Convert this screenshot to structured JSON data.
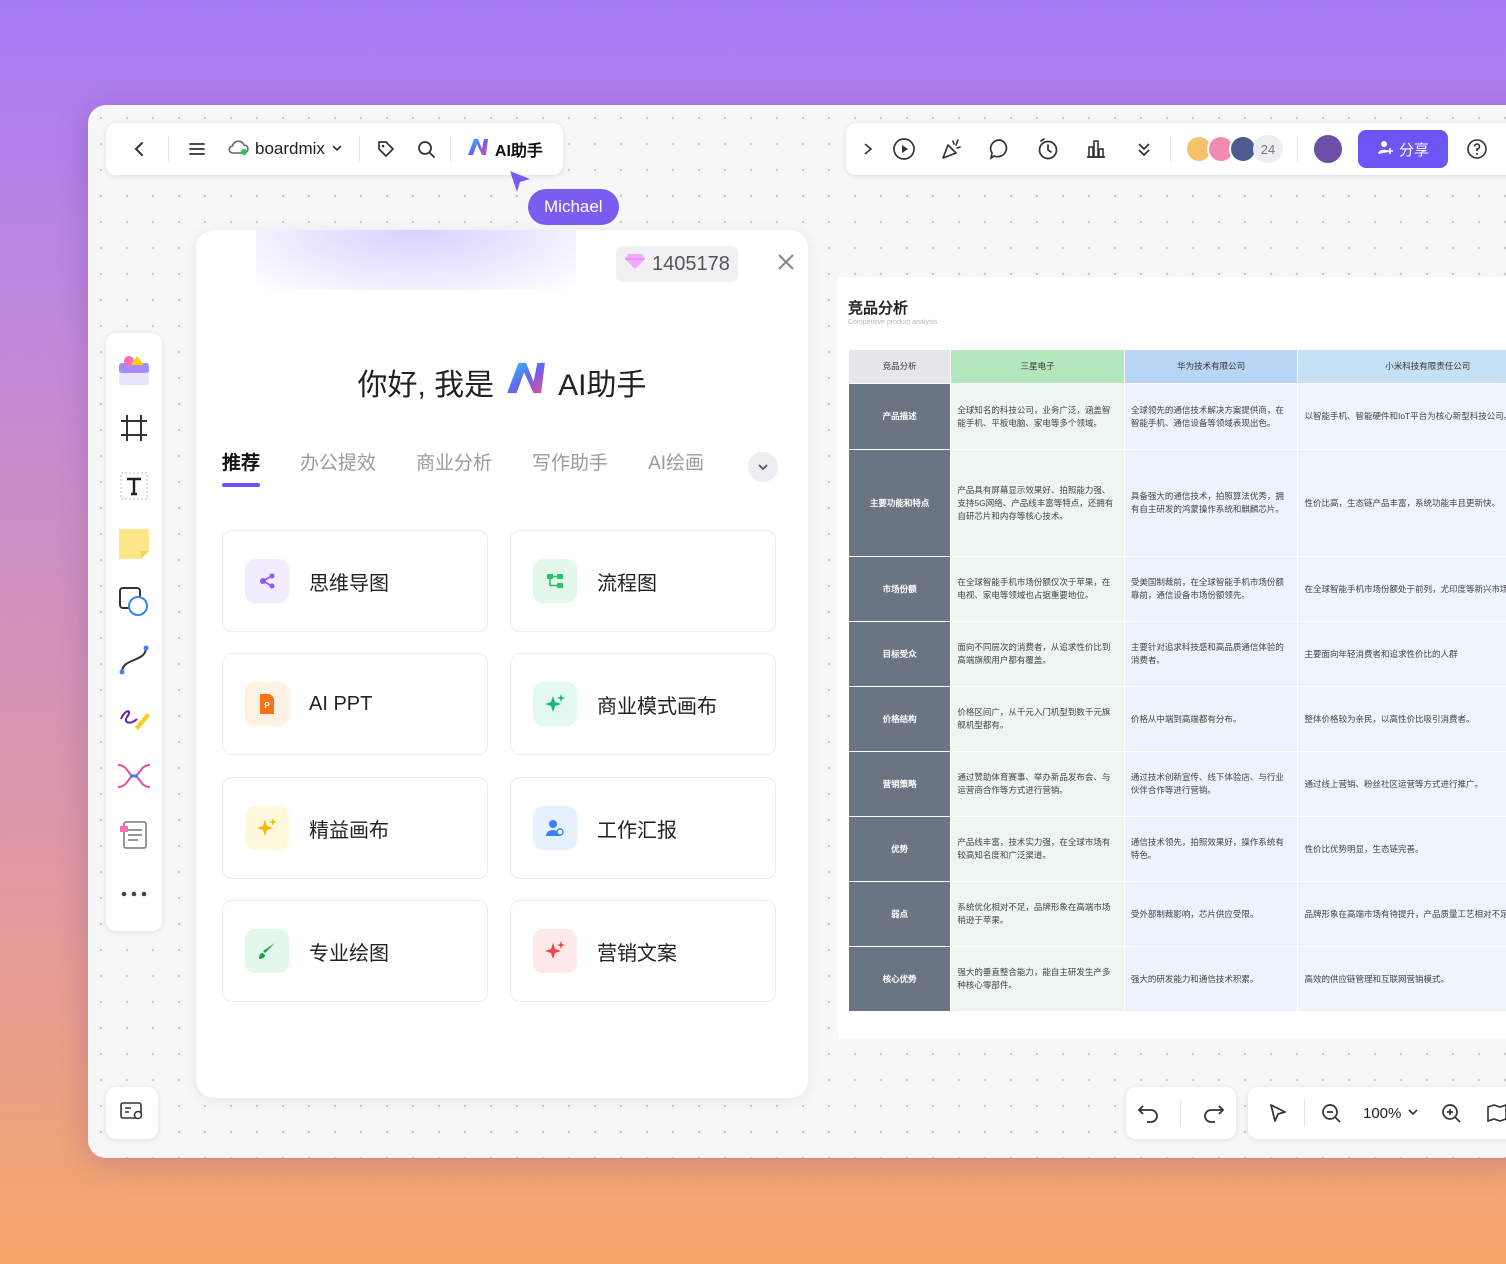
{
  "toolbar_left": {
    "brand": "boardmix",
    "ai_label": "AI助手"
  },
  "toolbar_right": {
    "collaborator_count": "24",
    "share_label": "分享"
  },
  "cursor": {
    "user": "Michael"
  },
  "ai_panel": {
    "credits": "1405178",
    "greeting_prefix": "你好, 我是",
    "greeting_suffix": "AI助手",
    "tabs": [
      "推荐",
      "办公提效",
      "商业分析",
      "写作助手",
      "AI绘画"
    ],
    "cards": [
      {
        "label": "思维导图",
        "icon": "mindmap-icon",
        "color": "#8b5cf6"
      },
      {
        "label": "流程图",
        "icon": "flowchart-icon",
        "color": "#22c55e"
      },
      {
        "label": "AI PPT",
        "icon": "ppt-icon",
        "color": "#f97316"
      },
      {
        "label": "商业模式画布",
        "icon": "sparkle-icon",
        "color": "#10b981"
      },
      {
        "label": "精益画布",
        "icon": "sparkle-icon",
        "color": "#f5b800"
      },
      {
        "label": "工作汇报",
        "icon": "user-report-icon",
        "color": "#3b82f6"
      },
      {
        "label": "专业绘图",
        "icon": "brush-icon",
        "color": "#16a34a"
      },
      {
        "label": "营销文案",
        "icon": "sparkle-icon",
        "color": "#ef4444"
      }
    ]
  },
  "sheet": {
    "title": "竞品分析",
    "subtitle": "Competitive product analysis",
    "headers": [
      "竞品分析",
      "三星电子",
      "华为技术有限公司",
      "小米科技有限责任公司"
    ],
    "rows": [
      {
        "label": "产品描述",
        "c1": "全球知名的科技公司，业务广泛，涵盖智能手机、平板电脑、家电等多个领域。",
        "c2": "全球领先的通信技术解决方案提供商，在智能手机、通信设备等领域表现出色。",
        "c3": "以智能手机、智能硬件和IoT平台为核心新型科技公司。"
      },
      {
        "label": "主要功能和特点",
        "c1": "产品具有屏幕显示效果好、拍照能力强、支持5G网络、产品线丰富等特点，还拥有自研芯片和内存等核心技术。",
        "c2": "具备强大的通信技术，拍照算法优秀，拥有自主研发的鸿蒙操作系统和麒麟芯片。",
        "c3": "性价比高，生态链产品丰富，系统功能丰且更新快。"
      },
      {
        "label": "市场份额",
        "c1": "在全球智能手机市场份额仅次于苹果，在电视、家电等领域也占据重要地位。",
        "c2": "受美国制裁前，在全球智能手机市场份额靠前，通信设备市场份额领先。",
        "c3": "在全球智能手机市场份额处于前列，尤印度等新兴市场表现突出。"
      },
      {
        "label": "目标受众",
        "c1": "面向不同层次的消费者，从追求性价比到高端旗舰用户都有覆盖。",
        "c2": "主要针对追求科技感和高品质通信体验的消费者。",
        "c3": "主要面向年轻消费者和追求性价比的人群"
      },
      {
        "label": "价格结构",
        "c1": "价格区间广，从千元入门机型到数千元旗舰机型都有。",
        "c2": "价格从中端到高端都有分布。",
        "c3": "整体价格较为亲民，以高性价比吸引消费者。"
      },
      {
        "label": "营销策略",
        "c1": "通过赞助体育赛事、举办新品发布会、与运营商合作等方式进行营销。",
        "c2": "通过技术创新宣传、线下体验店、与行业伙伴合作等进行营销。",
        "c3": "通过线上营销、粉丝社区运营等方式进行推广。"
      },
      {
        "label": "优势",
        "c1": "产品线丰富，技术实力强，在全球市场有较高知名度和广泛渠道。",
        "c2": "通信技术领先，拍照效果好，操作系统有特色。",
        "c3": "性价比优势明显，生态链完善。"
      },
      {
        "label": "弱点",
        "c1": "系统优化相对不足，品牌形象在高端市场稍逊于苹果。",
        "c2": "受外部制裁影响，芯片供应受限。",
        "c3": "品牌形象在高端市场有待提升，产品质量工艺相对不足。"
      },
      {
        "label": "核心优势",
        "c1": "强大的垂直整合能力，能自主研发生产多种核心零部件。",
        "c2": "强大的研发能力和通信技术积累。",
        "c3": "高效的供应链管理和互联网营销模式。"
      }
    ]
  },
  "zoom": {
    "level": "100%"
  }
}
